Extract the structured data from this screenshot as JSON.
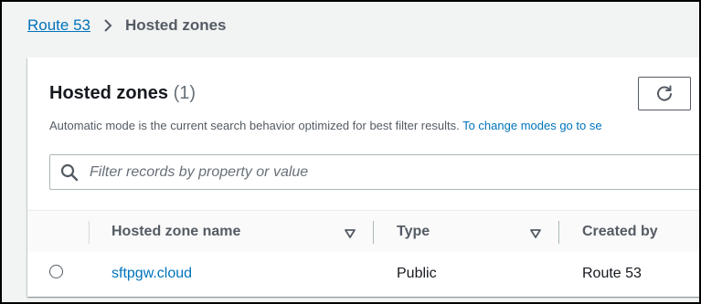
{
  "breadcrumb": {
    "root": "Route 53",
    "current": "Hosted zones"
  },
  "panel": {
    "title": "Hosted zones",
    "count": "(1)",
    "description": "Automatic mode is the current search behavior optimized for best filter results.",
    "description_link": "To change modes go to se"
  },
  "search": {
    "placeholder": "Filter records by property or value",
    "value": ""
  },
  "table": {
    "columns": [
      {
        "label": "Hosted zone name"
      },
      {
        "label": "Type"
      },
      {
        "label": "Created by"
      }
    ],
    "rows": [
      {
        "name": "sftpgw.cloud",
        "type": "Public",
        "created_by": "Route 53"
      }
    ]
  },
  "colors": {
    "link": "#0073bb",
    "text": "#16191f",
    "muted": "#545b64",
    "page_bg": "#f2f3f3"
  },
  "icons": {
    "breadcrumb_separator": "chevron-right-icon",
    "refresh": "refresh-icon",
    "search": "search-icon",
    "sort": "sort-down-icon"
  }
}
